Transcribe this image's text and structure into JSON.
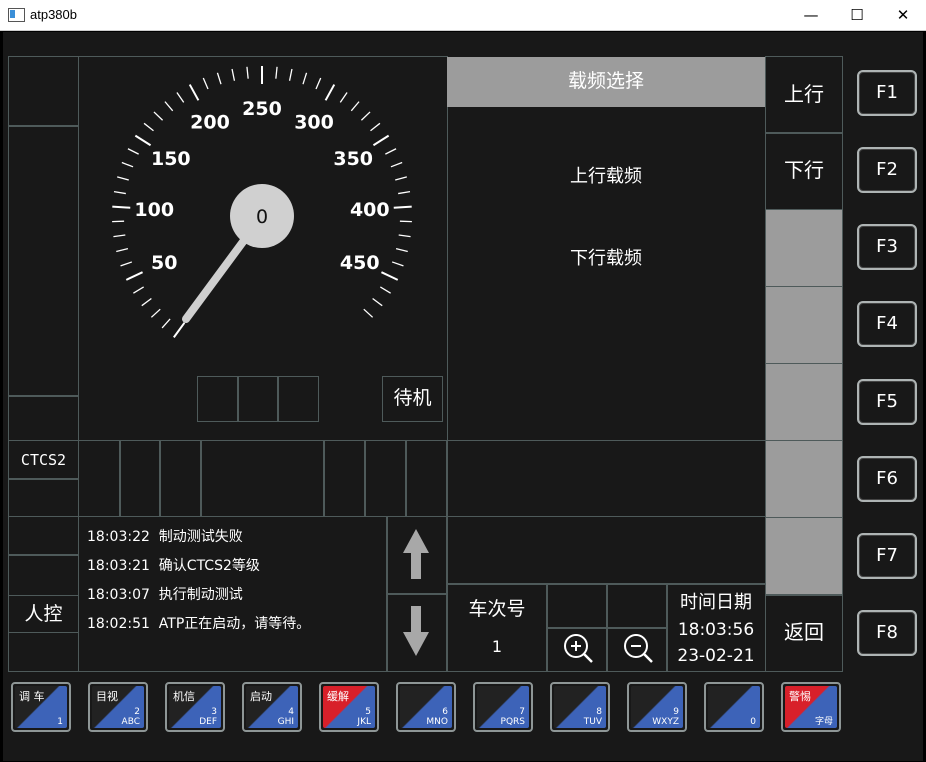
{
  "window": {
    "title": "atp380b",
    "minimize": "—",
    "maximize": "☐",
    "close": "✕"
  },
  "speedometer": {
    "current_speed": "0",
    "scale_labels": [
      "50",
      "100",
      "150",
      "200",
      "250",
      "300",
      "350",
      "400",
      "450"
    ],
    "status": "待机"
  },
  "level": "CTCS2",
  "mode": "人控",
  "messages": [
    {
      "time": "18:03:22",
      "text": "制动测试失败"
    },
    {
      "time": "18:03:21",
      "text": "确认CTCS2等级"
    },
    {
      "time": "18:03:07",
      "text": "执行制动测试"
    },
    {
      "time": "18:02:51",
      "text": "ATP正在启动，请等待。"
    }
  ],
  "menu": {
    "title": "载频选择",
    "items": [
      "上行载频",
      "下行载频"
    ]
  },
  "side_buttons": {
    "b1": "上行",
    "b2": "下行",
    "back": "返回"
  },
  "train": {
    "label": "车次号",
    "number": "1"
  },
  "clock": {
    "label": "时间日期",
    "time": "18:03:56",
    "date": "23-02-21"
  },
  "fkeys": [
    "F1",
    "F2",
    "F3",
    "F4",
    "F5",
    "F6",
    "F7",
    "F8"
  ],
  "keypad": [
    {
      "label": "调 车",
      "sub": "1",
      "color": "blue"
    },
    {
      "label": "目视",
      "sub": "2\nABC",
      "color": "blue"
    },
    {
      "label": "机信",
      "sub": "3\nDEF",
      "color": "blue"
    },
    {
      "label": "启动",
      "sub": "4\nGHI",
      "color": "blue"
    },
    {
      "label": "缓解",
      "sub": "5\nJKL",
      "color": "red"
    },
    {
      "label": "",
      "sub": "6\nMNO",
      "color": "blue"
    },
    {
      "label": "",
      "sub": "7\nPQRS",
      "color": "blue"
    },
    {
      "label": "",
      "sub": "8\nTUV",
      "color": "blue"
    },
    {
      "label": "",
      "sub": "9\nWXYZ",
      "color": "blue"
    },
    {
      "label": "",
      "sub": "0",
      "color": "blue"
    },
    {
      "label": "警惕",
      "sub": "字母",
      "color": "red"
    }
  ],
  "colors": {
    "bg": "#181818",
    "grid": "#4e5a5a",
    "panel_gray": "#9c9c9c",
    "key_blue": "#3d63b8",
    "key_red": "#d8202a"
  }
}
